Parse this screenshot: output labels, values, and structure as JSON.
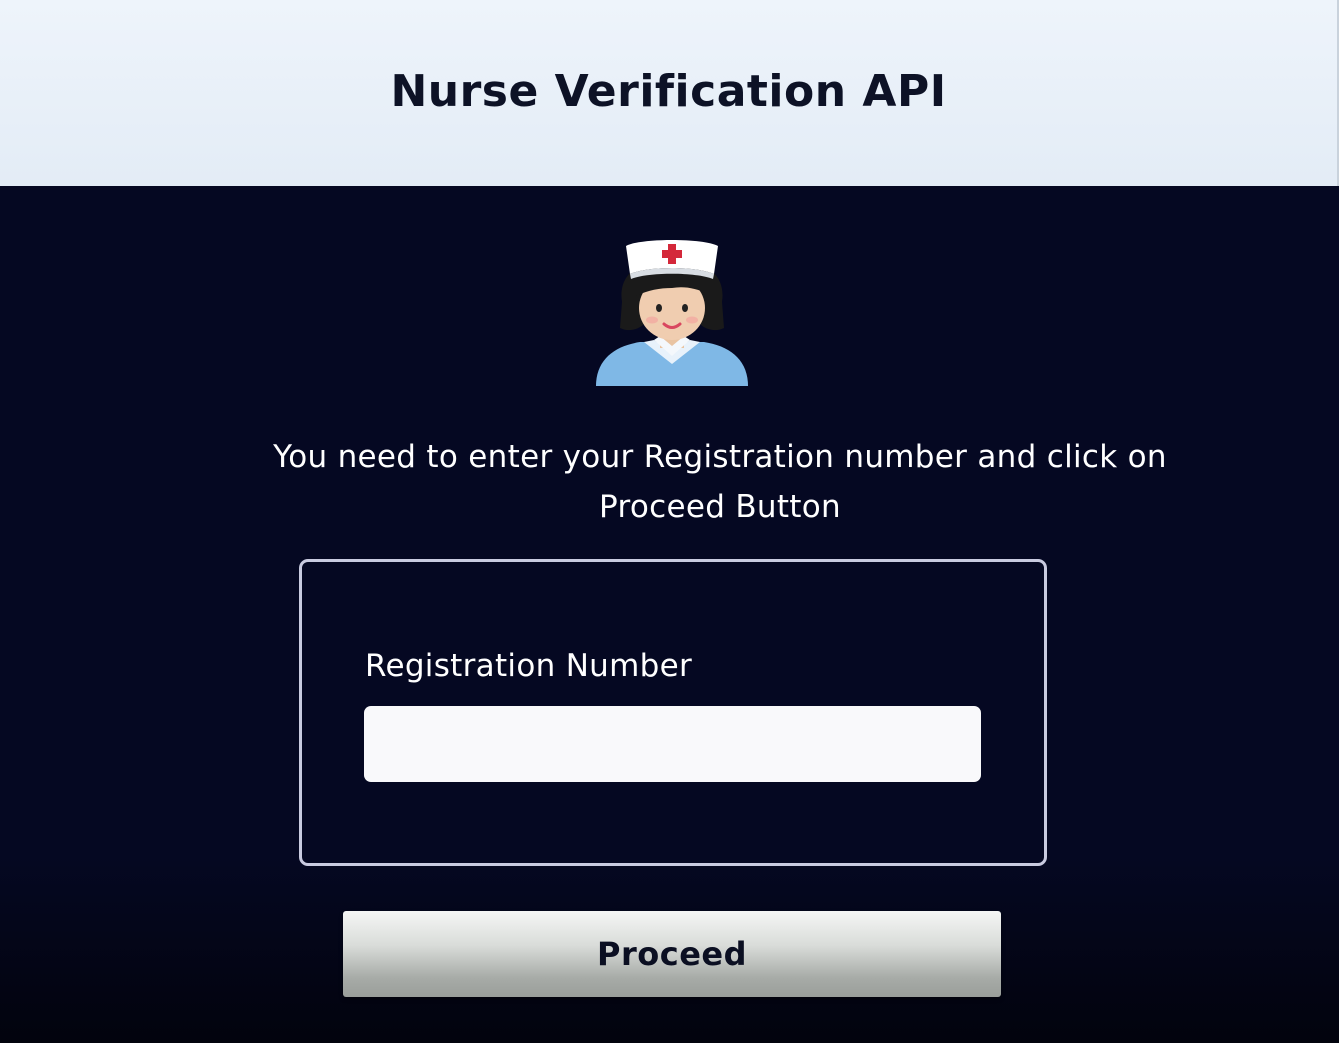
{
  "header": {
    "title": "Nurse Verification API"
  },
  "avatar": {
    "icon": "nurse-avatar-icon"
  },
  "instruction": {
    "line1": "You need to enter your Registration number and click on",
    "line2": "Proceed Button"
  },
  "form": {
    "registration_label": "Registration Number",
    "registration_value": "",
    "registration_placeholder": ""
  },
  "actions": {
    "proceed_label": "Proceed"
  },
  "colors": {
    "header_bg": "#e8eff8",
    "page_bg": "#050822",
    "text_light": "#ffffff",
    "text_dark": "#0d1226",
    "border": "#c9cbe0"
  }
}
